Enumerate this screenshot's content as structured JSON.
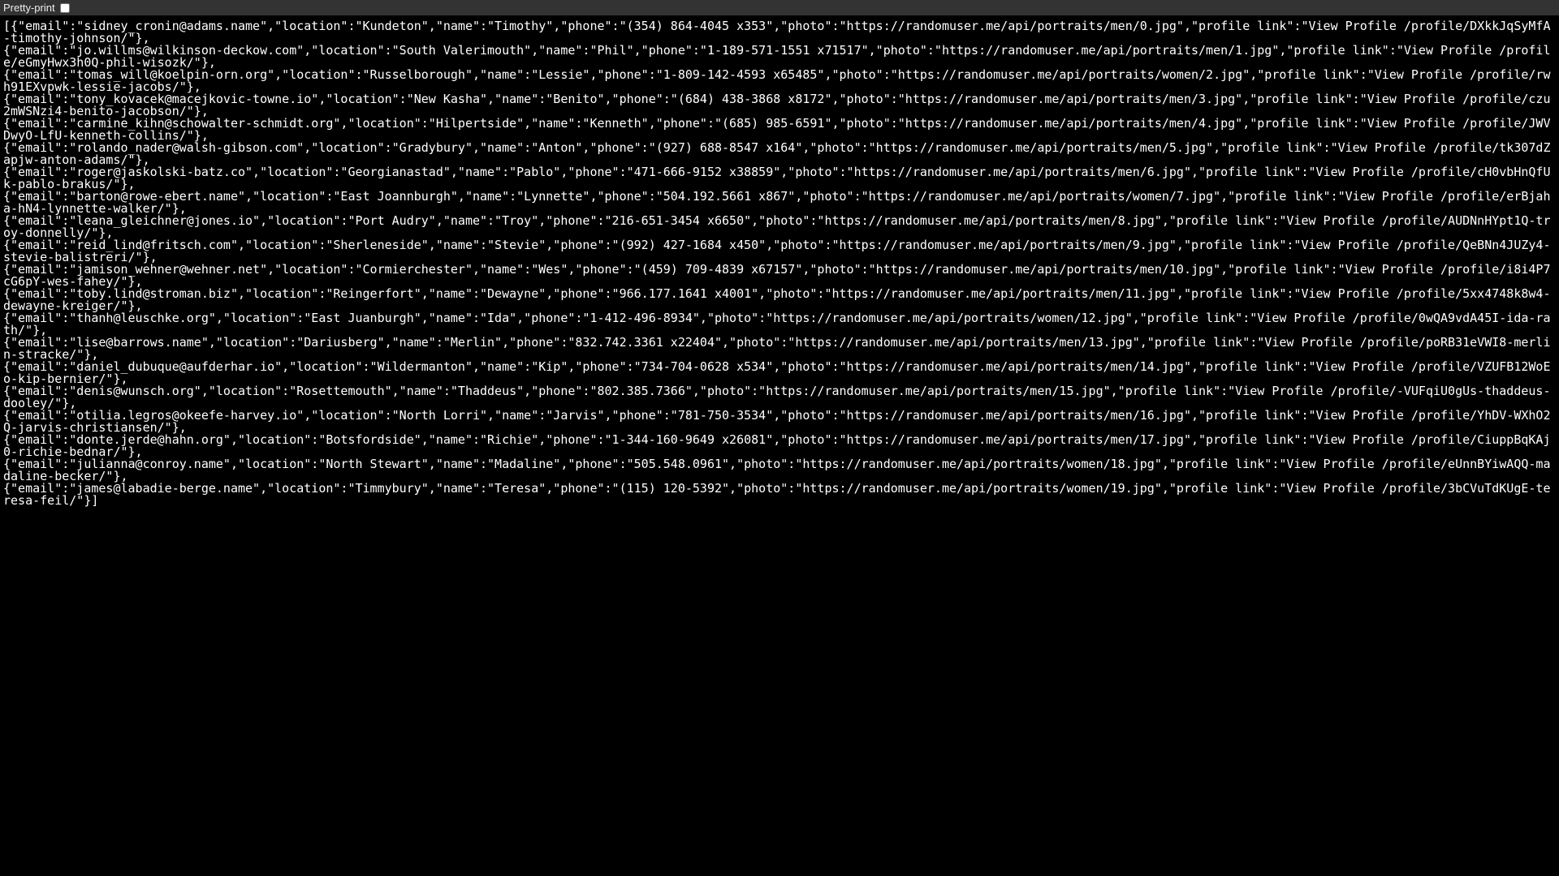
{
  "toolbar": {
    "pretty_print_label": "Pretty-print",
    "pretty_print_checked": false
  },
  "records": [
    {
      "email": "sidney_cronin@adams.name",
      "location": "Kundeton",
      "name": "Timothy",
      "phone": "(354) 864-4045 x353",
      "photo": "https://randomuser.me/api/portraits/men/0.jpg",
      "profile link": "View Profile /profile/DXkkJqSyMfA-timothy-johnson/"
    },
    {
      "email": "jo.willms@wilkinson-deckow.com",
      "location": "South Valerimouth",
      "name": "Phil",
      "phone": "1-189-571-1551 x71517",
      "photo": "https://randomuser.me/api/portraits/men/1.jpg",
      "profile link": "View Profile /profile/eGmyHwx3h0Q-phil-wisozk/"
    },
    {
      "email": "tomas_will@koelpin-orn.org",
      "location": "Russelborough",
      "name": "Lessie",
      "phone": "1-809-142-4593 x65485",
      "photo": "https://randomuser.me/api/portraits/women/2.jpg",
      "profile link": "View Profile /profile/rwh91EXvpwk-lessie-jacobs/"
    },
    {
      "email": "tony_kovacek@macejkovic-towne.io",
      "location": "New Kasha",
      "name": "Benito",
      "phone": "(684) 438-3868 x8172",
      "photo": "https://randomuser.me/api/portraits/men/3.jpg",
      "profile link": "View Profile /profile/czu2mWSNzi4-benito-jacobson/"
    },
    {
      "email": "carmine_kihn@schowalter-schmidt.org",
      "location": "Hilpertside",
      "name": "Kenneth",
      "phone": "(685) 985-6591",
      "photo": "https://randomuser.me/api/portraits/men/4.jpg",
      "profile link": "View Profile /profile/JWVDwyO-LfU-kenneth-collins/"
    },
    {
      "email": "rolando_nader@walsh-gibson.com",
      "location": "Gradybury",
      "name": "Anton",
      "phone": "(927) 688-8547 x164",
      "photo": "https://randomuser.me/api/portraits/men/5.jpg",
      "profile link": "View Profile /profile/tk307dZapjw-anton-adams/"
    },
    {
      "email": "roger@jaskolski-batz.co",
      "location": "Georgianastad",
      "name": "Pablo",
      "phone": "471-666-9152 x38859",
      "photo": "https://randomuser.me/api/portraits/men/6.jpg",
      "profile link": "View Profile /profile/cH0vbHnQfUk-pablo-brakus/"
    },
    {
      "email": "barton@rowe-ebert.name",
      "location": "East Joannburgh",
      "name": "Lynnette",
      "phone": "504.192.5661 x867",
      "photo": "https://randomuser.me/api/portraits/women/7.jpg",
      "profile link": "View Profile /profile/erBjaha-hN4-lynnette-walker/"
    },
    {
      "email": "leana_gleichner@jones.io",
      "location": "Port Audry",
      "name": "Troy",
      "phone": "216-651-3454 x6650",
      "photo": "https://randomuser.me/api/portraits/men/8.jpg",
      "profile link": "View Profile /profile/AUDNnHYpt1Q-troy-donnelly/"
    },
    {
      "email": "reid_lind@fritsch.com",
      "location": "Sherleneside",
      "name": "Stevie",
      "phone": "(992) 427-1684 x450",
      "photo": "https://randomuser.me/api/portraits/men/9.jpg",
      "profile link": "View Profile /profile/QeBNn4JUZy4-stevie-balistreri/"
    },
    {
      "email": "jamison_wehner@wehner.net",
      "location": "Cormierchester",
      "name": "Wes",
      "phone": "(459) 709-4839 x67157",
      "photo": "https://randomuser.me/api/portraits/men/10.jpg",
      "profile link": "View Profile /profile/i8i4P7cG6pY-wes-fahey/"
    },
    {
      "email": "toby.lind@stroman.biz",
      "location": "Reingerfort",
      "name": "Dewayne",
      "phone": "966.177.1641 x4001",
      "photo": "https://randomuser.me/api/portraits/men/11.jpg",
      "profile link": "View Profile /profile/5xx4748k8w4-dewayne-kreiger/"
    },
    {
      "email": "thanh@leuschke.org",
      "location": "East Juanburgh",
      "name": "Ida",
      "phone": "1-412-496-8934",
      "photo": "https://randomuser.me/api/portraits/women/12.jpg",
      "profile link": "View Profile /profile/0wQA9vdA45I-ida-rath/"
    },
    {
      "email": "lise@barrows.name",
      "location": "Dariusberg",
      "name": "Merlin",
      "phone": "832.742.3361 x22404",
      "photo": "https://randomuser.me/api/portraits/men/13.jpg",
      "profile link": "View Profile /profile/poRB31eVWI8-merlin-stracke/"
    },
    {
      "email": "daniel_dubuque@aufderhar.io",
      "location": "Wildermanton",
      "name": "Kip",
      "phone": "734-704-0628 x534",
      "photo": "https://randomuser.me/api/portraits/men/14.jpg",
      "profile link": "View Profile /profile/VZUFB12WoEo-kip-bernier/"
    },
    {
      "email": "denis@wunsch.org",
      "location": "Rosettemouth",
      "name": "Thaddeus",
      "phone": "802.385.7366",
      "photo": "https://randomuser.me/api/portraits/men/15.jpg",
      "profile link": "View Profile /profile/-VUFqiU0gUs-thaddeus-dooley/"
    },
    {
      "email": "otilia.legros@okeefe-harvey.io",
      "location": "North Lorri",
      "name": "Jarvis",
      "phone": "781-750-3534",
      "photo": "https://randomuser.me/api/portraits/men/16.jpg",
      "profile link": "View Profile /profile/YhDV-WXhO2Q-jarvis-christiansen/"
    },
    {
      "email": "donte.jerde@hahn.org",
      "location": "Botsfordside",
      "name": "Richie",
      "phone": "1-344-160-9649 x26081",
      "photo": "https://randomuser.me/api/portraits/men/17.jpg",
      "profile link": "View Profile /profile/CiuppBqKAj0-richie-bednar/"
    },
    {
      "email": "julianna@conroy.name",
      "location": "North Stewart",
      "name": "Madaline",
      "phone": "505.548.0961",
      "photo": "https://randomuser.me/api/portraits/women/18.jpg",
      "profile link": "View Profile /profile/eUnnBYiwAQQ-madaline-becker/"
    },
    {
      "email": "james@labadie-berge.name",
      "location": "Timmybury",
      "name": "Teresa",
      "phone": "(115) 120-5392",
      "photo": "https://randomuser.me/api/portraits/women/19.jpg",
      "profile link": "View Profile /profile/3bCVuTdKUgE-teresa-feil/"
    }
  ]
}
